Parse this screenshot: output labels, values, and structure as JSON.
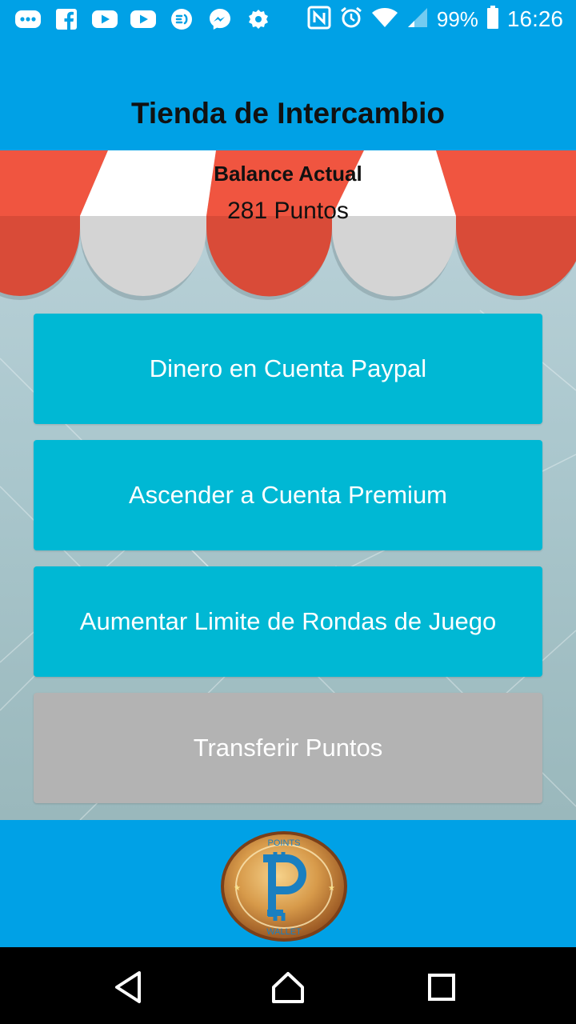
{
  "status_bar": {
    "battery_percent": "99%",
    "time": "16:26",
    "left_icons": [
      "more-icon",
      "facebook-icon",
      "youtube-icon",
      "youtube-icon",
      "chat-icon",
      "messenger-icon",
      "gear-icon"
    ],
    "right_icons": [
      "nfc-icon",
      "alarm-icon",
      "wifi-icon",
      "signal-icon",
      "battery-icon"
    ]
  },
  "app_bar": {
    "title": "Tienda de Intercambio"
  },
  "balance": {
    "title": "Balance Actual",
    "value": "281 Puntos"
  },
  "buttons": [
    {
      "label": "Dinero en Cuenta Paypal",
      "enabled": true
    },
    {
      "label": "Ascender a Cuenta Premium",
      "enabled": true
    },
    {
      "label": "Aumentar Limite de Rondas de Juego",
      "enabled": true
    },
    {
      "label": "Transferir Puntos",
      "enabled": false
    }
  ],
  "footer": {
    "logo_top_text": "POINTS",
    "logo_bottom_text": "WALLET",
    "logo_symbol": "P"
  },
  "nav_bar": {
    "icons": [
      "back-icon",
      "home-icon",
      "recents-icon"
    ]
  },
  "colors": {
    "primary": "#00a1e6",
    "button": "#00b8d4",
    "button_disabled": "#b3b3b3",
    "awning_red": "#f05540",
    "awning_white": "#ffffff"
  }
}
